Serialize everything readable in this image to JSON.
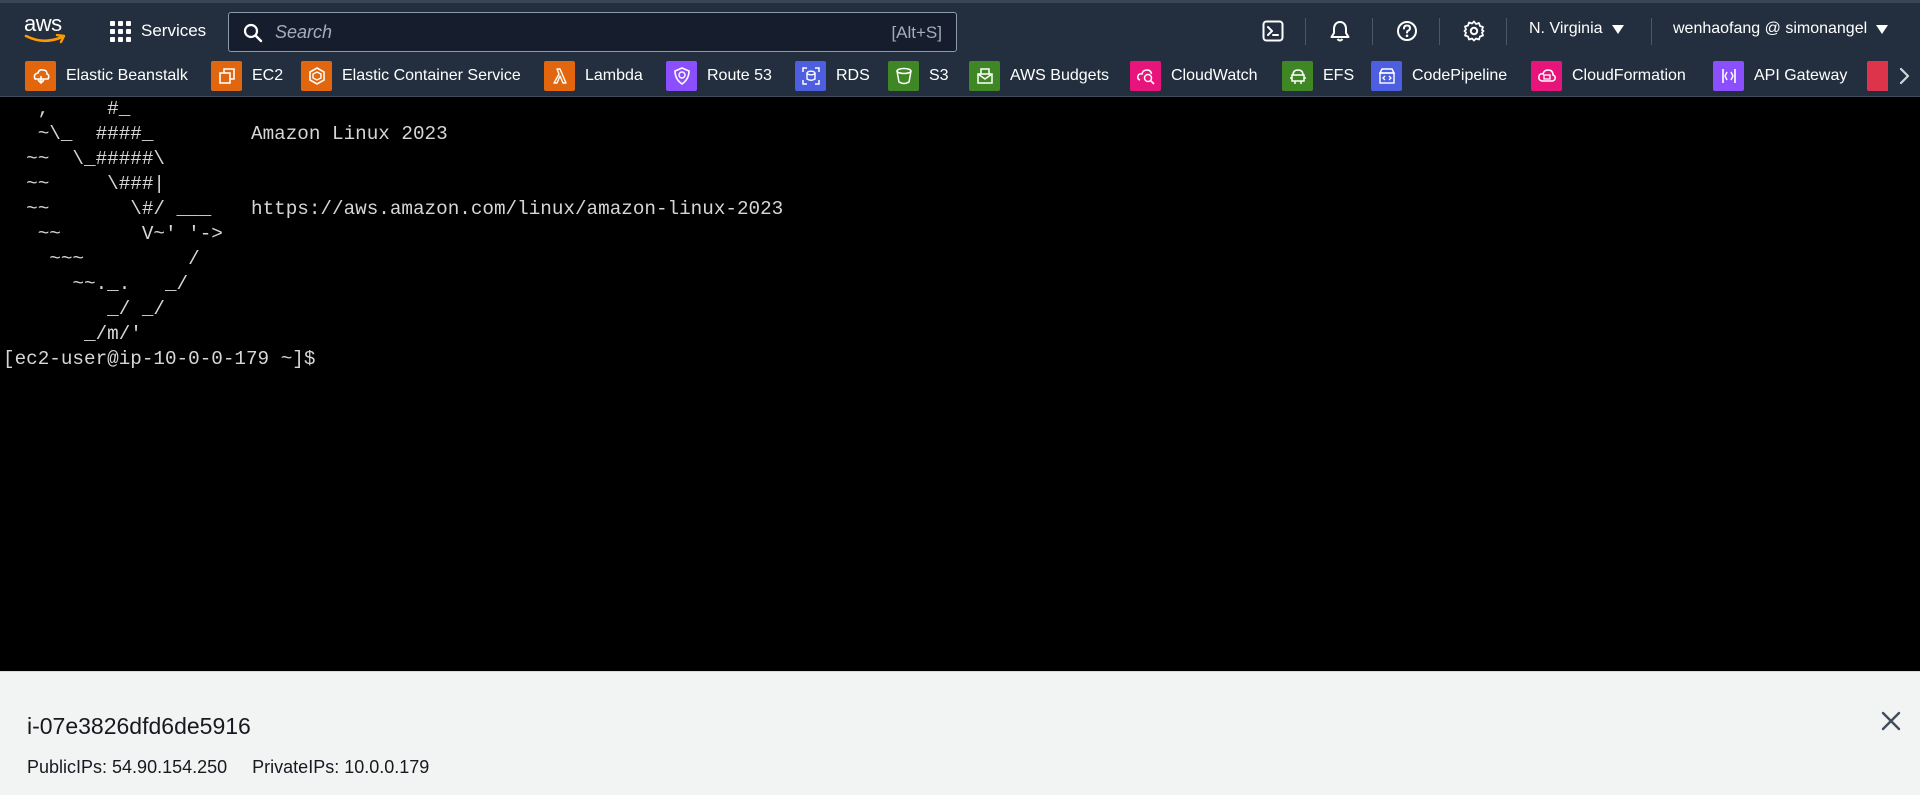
{
  "header": {
    "logo_text": "aws",
    "services_label": "Services",
    "search": {
      "placeholder": "Search",
      "shortcut": "[Alt+S]"
    },
    "icons": [
      "cloudshell-icon",
      "bell-icon",
      "help-icon",
      "gear-icon"
    ],
    "region": "N. Virginia",
    "account": "wenhaofang @ simonangel"
  },
  "favorites": [
    {
      "label": "Elastic Beanstalk",
      "color": "#e2660e"
    },
    {
      "label": "EC2",
      "color": "#e2660e"
    },
    {
      "label": "Elastic Container Service",
      "color": "#e2660e"
    },
    {
      "label": "Lambda",
      "color": "#e2660e"
    },
    {
      "label": "Route 53",
      "color": "#8c4fff"
    },
    {
      "label": "RDS",
      "color": "#4d5fe0"
    },
    {
      "label": "S3",
      "color": "#3f8624"
    },
    {
      "label": "AWS Budgets",
      "color": "#3f8624"
    },
    {
      "label": "CloudWatch",
      "color": "#e7157b"
    },
    {
      "label": "EFS",
      "color": "#3f8624"
    },
    {
      "label": "CodePipeline",
      "color": "#4d5fe0"
    },
    {
      "label": "CloudFormation",
      "color": "#e7157b"
    },
    {
      "label": "API Gateway",
      "color": "#8c4fff"
    }
  ],
  "terminal": {
    "art": [
      "   ,     #_",
      "   ~\\_  ####_",
      "  ~~  \\_#####\\",
      "  ~~     \\###|",
      "  ~~       \\#/ ___",
      "   ~~       V~' '->",
      "    ~~~         /",
      "      ~~._.   _/",
      "         _/ _/",
      "       _/m/'"
    ],
    "title": "Amazon Linux 2023",
    "url": "https://aws.amazon.com/linux/amazon-linux-2023",
    "prompt": "[ec2-user@ip-10-0-0-179 ~]$"
  },
  "footer": {
    "instance_id": "i-07e3826dfd6de5916",
    "public_ips": "PublicIPs: 54.90.154.250",
    "private_ips": "PrivateIPs: 10.0.0.179"
  }
}
